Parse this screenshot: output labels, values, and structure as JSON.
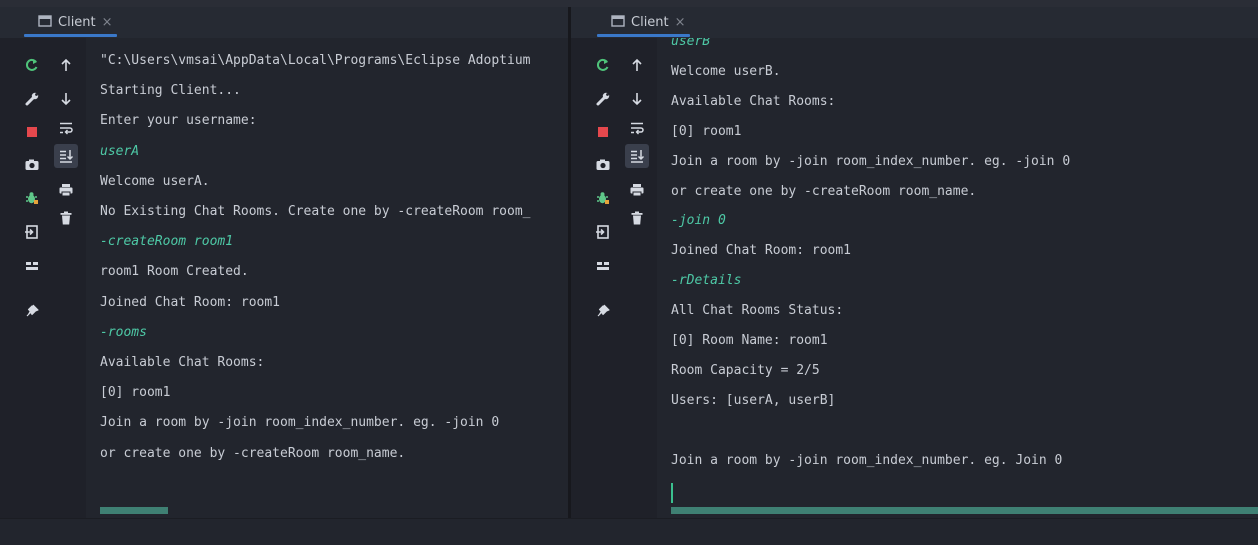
{
  "colors": {
    "accent_tab": "#3a78c9",
    "input_text": "#4ec9a6",
    "output_text": "#c8ccd4",
    "scrollbar": "#3f8073"
  },
  "left": {
    "tab_label": "Client",
    "lines": [
      {
        "text": "\"C:\\Users\\vmsai\\AppData\\Local\\Programs\\Eclipse Adoptium",
        "input": false
      },
      {
        "text": "Starting Client...",
        "input": false
      },
      {
        "text": "Enter your username:",
        "input": false
      },
      {
        "text": "userA",
        "input": true
      },
      {
        "text": "Welcome userA.",
        "input": false
      },
      {
        "text": "No Existing Chat Rooms. Create one by -createRoom room_",
        "input": false
      },
      {
        "text": "-createRoom room1",
        "input": true
      },
      {
        "text": "room1 Room Created.",
        "input": false
      },
      {
        "text": "Joined Chat Room: room1",
        "input": false
      },
      {
        "text": "-rooms",
        "input": true
      },
      {
        "text": "Available Chat Rooms:",
        "input": false
      },
      {
        "text": "[0] room1",
        "input": false
      },
      {
        "text": "Join a room by -join room_index_number. eg. -join 0",
        "input": false
      },
      {
        "text": "or create one by -createRoom room_name.",
        "input": false
      }
    ]
  },
  "right": {
    "tab_label": "Client",
    "lines": [
      {
        "text": "userB",
        "input": true
      },
      {
        "text": "Welcome userB.",
        "input": false
      },
      {
        "text": "Available Chat Rooms:",
        "input": false
      },
      {
        "text": "[0] room1",
        "input": false
      },
      {
        "text": "Join a room by -join room_index_number. eg. -join 0",
        "input": false
      },
      {
        "text": "or create one by -createRoom room_name.",
        "input": false
      },
      {
        "text": "-join 0",
        "input": true
      },
      {
        "text": "Joined Chat Room: room1",
        "input": false
      },
      {
        "text": "-rDetails",
        "input": true
      },
      {
        "text": "All Chat Rooms Status:",
        "input": false
      },
      {
        "text": "[0] Room Name: room1",
        "input": false
      },
      {
        "text": "Room Capacity = 2/5",
        "input": false
      },
      {
        "text": "Users: [userA, userB]",
        "input": false
      },
      {
        "text": "",
        "input": false
      },
      {
        "text": "Join a room by -join room_index_number. eg. Join 0",
        "input": false
      }
    ]
  },
  "toolbar_icons": {
    "left_column": [
      "rerun-icon",
      "wrench-icon",
      "stop-icon",
      "camera-icon",
      "debug-bug-icon",
      "exit-icon",
      "layout-icon",
      "pin-icon"
    ],
    "right_column": [
      "arrow-up-icon",
      "arrow-down-icon",
      "soft-wrap-icon",
      "scroll-to-end-icon",
      "print-icon",
      "trash-icon"
    ]
  }
}
